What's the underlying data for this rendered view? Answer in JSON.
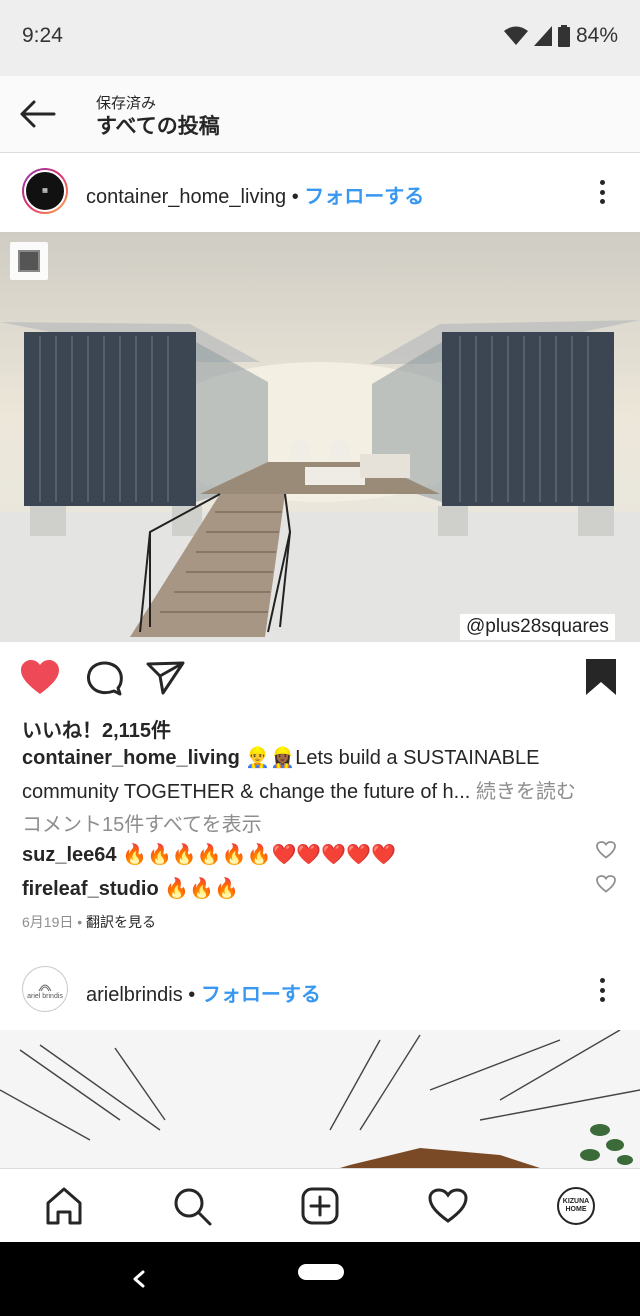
{
  "status_bar": {
    "time": "9:24",
    "battery": "84%"
  },
  "header": {
    "subtitle": "保存済み",
    "title": "すべての投稿"
  },
  "post1": {
    "username": "container_home_living",
    "separator": " • ",
    "follow_label": "フォローする",
    "watermark": "@plus28squares",
    "likes": "いいね！2,115件",
    "caption_user": "container_home_living",
    "caption_emoji": "👷‍♂️👷🏾‍♀️",
    "caption_line1": "Lets build a SUSTAINABLE",
    "caption_line2": "community TOGETHER & change the future of h...",
    "more_label": "続きを読む",
    "view_comments": "コメント15件すべてを表示",
    "comments": [
      {
        "user": "suz_lee64",
        "text": "🔥🔥🔥🔥🔥🔥❤️❤️❤️❤️❤️"
      },
      {
        "user": "fireleaf_studio",
        "text": "🔥🔥🔥"
      }
    ],
    "date": "6月19日",
    "date_separator": " • ",
    "translate_label": "翻訳を見る"
  },
  "post2": {
    "username": "arielbrindis",
    "separator": " • ",
    "follow_label": "フォローする",
    "avatar_text": "ariel brindis"
  },
  "nav": {
    "items": [
      "home-icon",
      "search-icon",
      "add-post-icon",
      "activity-heart-icon",
      "profile-avatar"
    ],
    "profile_avatar_text_1": "KIZUNA",
    "profile_avatar_text_2": "HOME"
  },
  "colors": {
    "link": "#3897f0",
    "like": "#ed4956",
    "text": "#262626",
    "muted": "#8e8e8e"
  }
}
